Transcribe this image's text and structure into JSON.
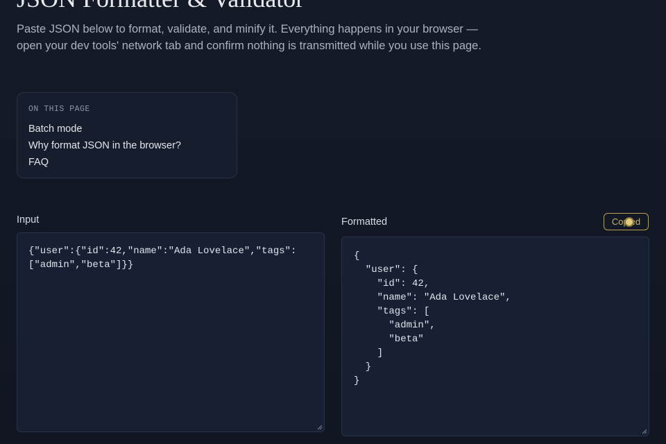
{
  "page": {
    "title": "JSON Formatter & Validator",
    "intro": "Paste JSON below to format, validate, and minify it. Everything happens in your browser — open your dev tools' network tab and confirm nothing is transmitted while you use this page."
  },
  "toc": {
    "heading": "ON THIS PAGE",
    "items": [
      "Batch mode",
      "Why format JSON in the browser?",
      "FAQ"
    ]
  },
  "input": {
    "label": "Input",
    "value": "{\"user\":{\"id\":42,\"name\":\"Ada Lovelace\",\"tags\":[\"admin\",\"beta\"]}}"
  },
  "output": {
    "label": "Formatted",
    "copy_label": "Copied",
    "value": "{\n  \"user\": {\n    \"id\": 42,\n    \"name\": \"Ada Lovelace\",\n    \"tags\": [\n      \"admin\",\n      \"beta\"\n    ]\n  }\n}"
  },
  "colors": {
    "background": "#121725",
    "panel": "#172033",
    "accent": "#c9b56a"
  }
}
